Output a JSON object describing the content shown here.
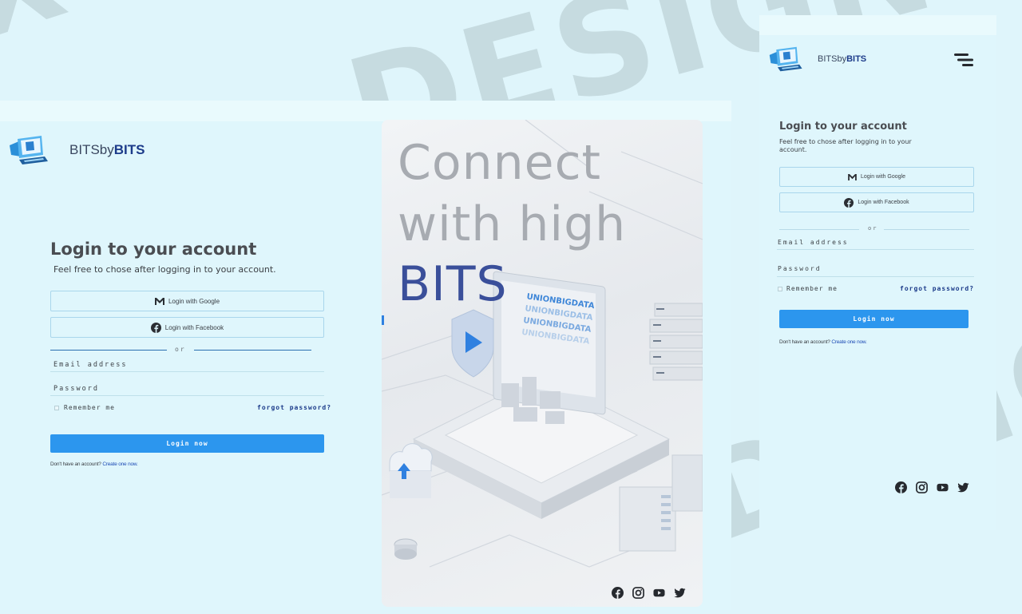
{
  "brand": {
    "name_light": "BITSby",
    "name_bold": "BITS"
  },
  "login": {
    "title": "Login to your account",
    "subtitle": "Feel free to chose after logging  in to your account.",
    "google_label": "Login with Google",
    "facebook_label": "Login with Facebook",
    "or_label": "or",
    "email_label": "Email address",
    "password_label": "Password",
    "remember_label": "Remember me",
    "forgot_label": "forgot password?",
    "login_button": "Login now",
    "signup_prompt": "Don't have an account?",
    "signup_link": "Create one now."
  },
  "hero": {
    "line1": "Connect",
    "line2": "with high",
    "line3": "BITS",
    "screen_texts": [
      "UNIONBIGDATA",
      "UNIONBIGDATA",
      "UNIONBIGDATA",
      "UNIONBIGDATA"
    ]
  },
  "social_icons": [
    "facebook-icon",
    "instagram-icon",
    "youtube-icon",
    "twitter-icon"
  ],
  "background_words": [
    "X DESIGN",
    "DESIGN",
    "DESIGN"
  ],
  "colors": {
    "page_bg": "#dff5fb",
    "panel_bg": "#dff6fc",
    "brand_dark": "#1c3b8a",
    "button_blue": "#2c96ee",
    "heading": "#4a4d52",
    "watermark": "#c6dbe0",
    "hero_bits": "#3a4f9a"
  }
}
